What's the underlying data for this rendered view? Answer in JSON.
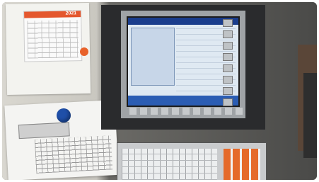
{
  "calendar": {
    "year": "2021"
  }
}
